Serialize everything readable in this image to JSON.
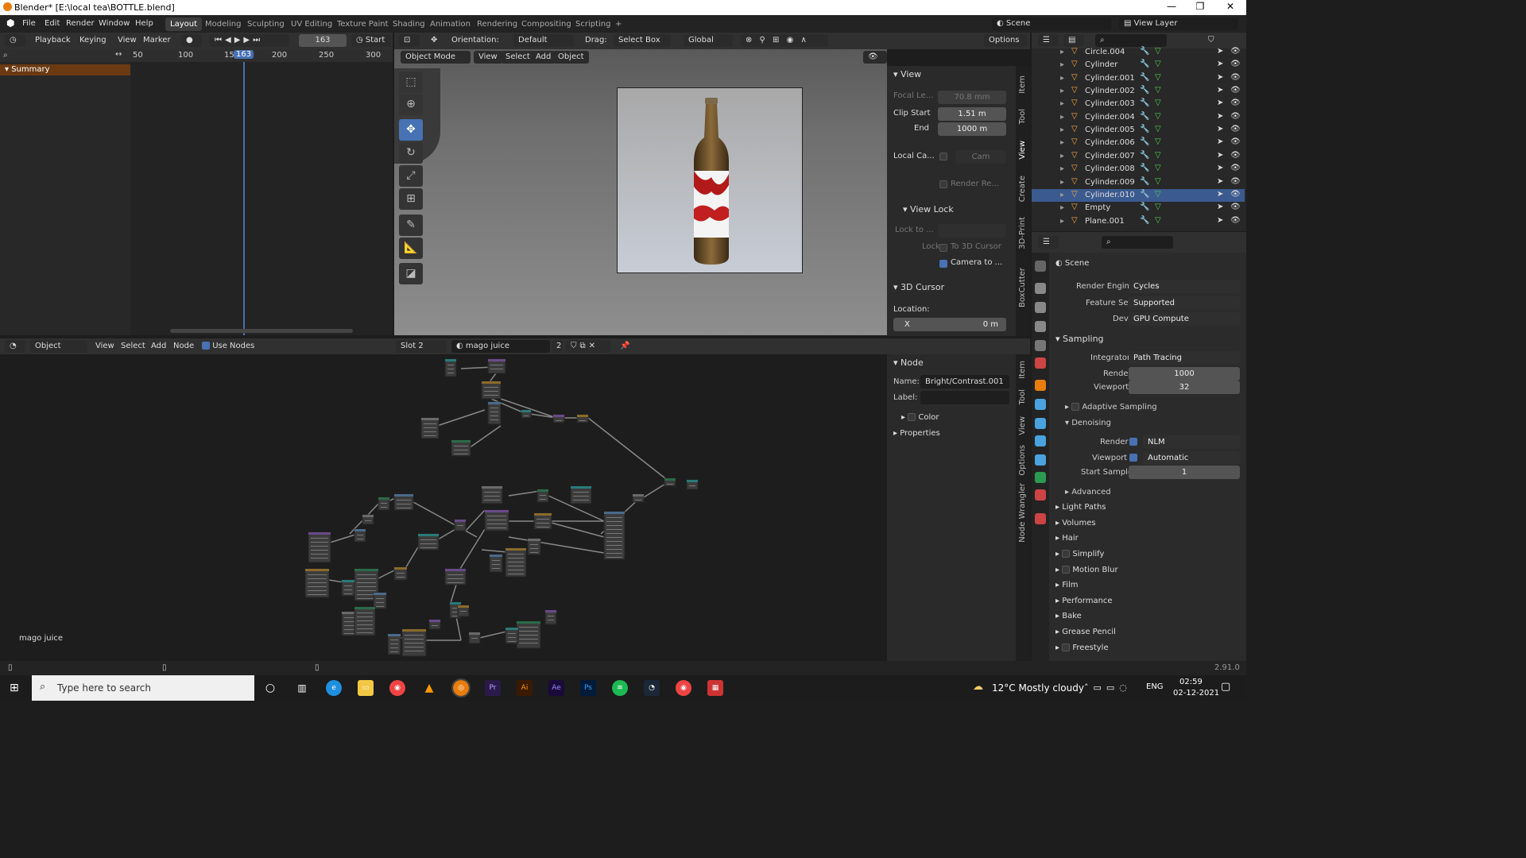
{
  "window": {
    "title": "Blender* [E:\\local tea\\BOTTLE.blend]",
    "min": "—",
    "max": "❐",
    "close": "✕"
  },
  "menus": [
    "File",
    "Edit",
    "Render",
    "Window",
    "Help"
  ],
  "workspaces": [
    "Layout",
    "Modeling",
    "Sculpting",
    "UV Editing",
    "Texture Paint",
    "Shading",
    "Animation",
    "Rendering",
    "Compositing",
    "Scripting",
    "+"
  ],
  "scene": {
    "label": "Scene",
    "view_layer": "View Layer"
  },
  "timeline": {
    "playback": "Playback",
    "keying": "Keying",
    "view": "View",
    "marker": "Marker",
    "frame": "163",
    "start": "Start",
    "ticks": [
      "50",
      "100",
      "150",
      "200",
      "250",
      "300"
    ],
    "current": "163",
    "summary": "Summary"
  },
  "viewport": {
    "orientation_label": "Orientation:",
    "orientation": "Default",
    "drag_label": "Drag:",
    "drag": "Select Box",
    "global": "Global",
    "options": "Options",
    "mode": "Object Mode",
    "menu": [
      "View",
      "Select",
      "Add",
      "Object"
    ]
  },
  "npanel": {
    "view_title": "View",
    "focal_label": "Focal Le...",
    "focal": "70.8 mm",
    "clip_start_label": "Clip Start",
    "clip_start": "1.51 m",
    "end_label": "End",
    "end": "1000 m",
    "local_cam_label": "Local Ca...",
    "local_cam": "Cam",
    "render_region": "Render Re...",
    "view_lock_title": "View Lock",
    "lock_to": "Lock to ...",
    "lock_label": "Lock",
    "to_cursor": "To 3D Cursor",
    "camera_to": "Camera to ...",
    "cursor_title": "3D Cursor",
    "location_label": "Location:",
    "x_label": "X",
    "x_value": "0 m"
  },
  "viewport_tabs": [
    "Item",
    "Tool",
    "View",
    "Create",
    "3D-Print",
    "BoxCutter"
  ],
  "outliner": [
    {
      "name": "Circle.004",
      "sel": false
    },
    {
      "name": "Cylinder",
      "sel": false
    },
    {
      "name": "Cylinder.001",
      "sel": false
    },
    {
      "name": "Cylinder.002",
      "sel": false
    },
    {
      "name": "Cylinder.003",
      "sel": false
    },
    {
      "name": "Cylinder.004",
      "sel": false
    },
    {
      "name": "Cylinder.005",
      "sel": false
    },
    {
      "name": "Cylinder.006",
      "sel": false
    },
    {
      "name": "Cylinder.007",
      "sel": false
    },
    {
      "name": "Cylinder.008",
      "sel": false
    },
    {
      "name": "Cylinder.009",
      "sel": false
    },
    {
      "name": "Cylinder.010",
      "sel": true
    },
    {
      "name": "Empty",
      "sel": false
    },
    {
      "name": "Plane.001",
      "sel": false
    }
  ],
  "node_editor": {
    "object": "Object",
    "menu": [
      "View",
      "Select",
      "Add",
      "Node"
    ],
    "use_nodes": "Use Nodes",
    "slot": "Slot 2",
    "material": "mago juice",
    "users": "2",
    "footer_label": "mago juice"
  },
  "node_panel": {
    "node_title": "Node",
    "name_label": "Name:",
    "name": "Bright/Contrast.001",
    "label_label": "Label:",
    "color": "Color",
    "properties": "Properties"
  },
  "node_tabs": [
    "Item",
    "Tool",
    "View",
    "Options",
    "Node Wrangler"
  ],
  "properties": {
    "scene": "Scene",
    "render_engine_label": "Render Engine",
    "render_engine": "Cycles",
    "feature_set_label": "Feature Set",
    "feature_set": "Supported",
    "device_label": "Device",
    "device": "GPU Compute",
    "sampling": "Sampling",
    "integrator_label": "Integrator",
    "integrator": "Path Tracing",
    "render_label": "Render",
    "render": "1000",
    "viewport_label": "Viewport",
    "viewport": "32",
    "adaptive": "Adaptive Sampling",
    "denoising": "Denoising",
    "den_render_label": "Render",
    "den_render": "NLM",
    "den_viewport_label": "Viewport",
    "den_viewport": "Automatic",
    "start_sample_label": "Start Sample",
    "start_sample": "1",
    "advanced": "Advanced",
    "light_paths": "Light Paths",
    "volumes": "Volumes",
    "hair": "Hair",
    "simplify": "Simplify",
    "motion_blur": "Motion Blur",
    "film": "Film",
    "performance": "Performance",
    "bake": "Bake",
    "grease_pencil": "Grease Pencil",
    "freestyle": "Freestyle"
  },
  "status": {
    "version": "2.91.0"
  },
  "taskbar": {
    "search": "Type here to search",
    "weather": "12°C  Mostly cloudy",
    "lang": "ENG",
    "time": "02:59",
    "date": "02-12-2021"
  }
}
